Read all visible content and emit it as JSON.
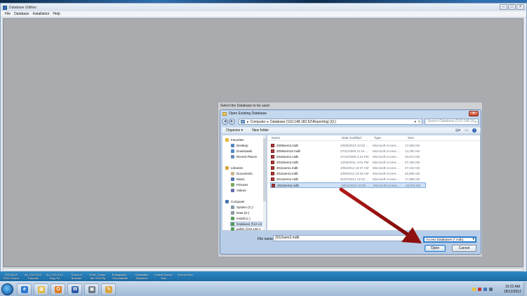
{
  "app": {
    "title": "Database Utilities",
    "menu": [
      "File",
      "Database",
      "Installation",
      "Help"
    ],
    "window_controls": [
      "minimize-icon",
      "maximize-icon",
      "close-icon"
    ]
  },
  "select_panel": {
    "title": "Select the Database to be used"
  },
  "dialog": {
    "title": "Open Existing Database",
    "close_glyph": "✕",
    "breadcrumb": [
      "Computer",
      "Database (\\\\10.148.182.52\\Reporting) (Q:)"
    ],
    "search_placeholder": "Search Database (\\\\10.148.18...",
    "toolbar": {
      "organize": "Organize ▾",
      "new_folder": "New folder"
    },
    "nav_pane": [
      {
        "label": "Favorites",
        "icon": "star-icon",
        "color": "#e8b732"
      },
      {
        "label": "Desktop",
        "icon": "desktop-icon",
        "color": "#4f85c6"
      },
      {
        "label": "Downloads",
        "icon": "downloads-icon",
        "color": "#4f85c6"
      },
      {
        "label": "Recent Places",
        "icon": "recent-places-icon",
        "color": "#6b8cb5"
      },
      {
        "label": "Libraries",
        "icon": "libraries-icon",
        "color": "#d9a73b"
      },
      {
        "label": "Documents",
        "icon": "documents-icon",
        "color": "#c9b68a"
      },
      {
        "label": "Music",
        "icon": "music-icon",
        "color": "#5177b0"
      },
      {
        "label": "Pictures",
        "icon": "pictures-icon",
        "color": "#7aa85a"
      },
      {
        "label": "Videos",
        "icon": "videos-icon",
        "color": "#6a6fae"
      },
      {
        "label": "Computer",
        "icon": "computer-icon",
        "color": "#4a76b0"
      },
      {
        "label": "System (C:)",
        "icon": "drive-icon",
        "color": "#8a96a6"
      },
      {
        "label": "Data (D:)",
        "icon": "drive-icon",
        "color": "#8a96a6"
      },
      {
        "label": "Install (L:)",
        "icon": "network-drive-icon",
        "color": "#5e9a5e"
      },
      {
        "label": "Database (\\\\10.14",
        "icon": "network-drive-icon",
        "color": "#5e9a5e"
      },
      {
        "label": "public (\\\\10.148.1",
        "icon": "network-drive-icon",
        "color": "#5e9a5e"
      }
    ],
    "columns": {
      "name": "Name",
      "date": "Date modified",
      "type": "Type",
      "size": "Size"
    },
    "files": [
      {
        "name": "2009sem2.mdb",
        "date": "20/05/2010 10:03 ...",
        "type": "Microsoft Access ...",
        "size": "17,806 KB"
      },
      {
        "name": "2009sem2X.mdb",
        "date": "27/11/2009 11:16 ...",
        "type": "Microsoft Access ...",
        "size": "14,292 KB"
      },
      {
        "name": "2010sem1.mdb",
        "date": "27/10/2009 2:23 PM",
        "type": "Microsoft Access ...",
        "size": "20,874 KB"
      },
      {
        "name": "2010sem2.mdb",
        "date": "12/05/2011 3:01 PM",
        "type": "Microsoft Access ...",
        "size": "27,256 KB"
      },
      {
        "name": "2011sem1.mdb",
        "date": "4/05/2012 10:37 AM",
        "type": "Microsoft Access ...",
        "size": "27,242 KB"
      },
      {
        "name": "2011sem2.mdb",
        "date": "4/05/2012 10:33 AM",
        "type": "Microsoft Access ...",
        "size": "26,866 KB"
      },
      {
        "name": "2012sem1.mdb",
        "date": "31/07/2012 12:23 ...",
        "type": "Microsoft Access ...",
        "size": "17,966 KB"
      },
      {
        "name": "2012sem2.mdb",
        "date": "18/12/2012 10:20 ...",
        "type": "Microsoft Access ...",
        "size": "10,874 KB"
      }
    ],
    "selected_file_index": 7,
    "filename_label": "File name:",
    "filename_value": "2012sem2.mdb",
    "filetype": "Access Databases (*.mdb)",
    "open_label": "Open",
    "cancel_label": "Cancel"
  },
  "desktop_labels": [
    "2012\\AUS 2012 \\Gonzo",
    "AV_ISO 2012 Tutorials",
    "AV_ISO 2012 Dwg Tut",
    "Gonzo-It Browser",
    "NSW_Conta... the VSO Rp.",
    "Eufingaarti... Gonzalaville",
    "Catsmakin Stephens",
    "Eufinit Gunsol Vow",
    "Euzha Eliza"
  ],
  "taskbar": {
    "apps": [
      {
        "name": "ie",
        "glyph": "e",
        "color": "#2b7ad1"
      },
      {
        "name": "explorer",
        "glyph": "▦",
        "color": "#e0b840"
      },
      {
        "name": "outlook",
        "glyph": "O",
        "color": "#e07b1e"
      },
      {
        "name": "word",
        "glyph": "W",
        "color": "#2b5aa8"
      },
      {
        "name": "utility",
        "glyph": "▣",
        "color": "#6a7582"
      },
      {
        "name": "tool",
        "glyph": "✎",
        "color": "#d9a640"
      }
    ],
    "time": "10:22 AM",
    "date": "18/12/2012"
  }
}
